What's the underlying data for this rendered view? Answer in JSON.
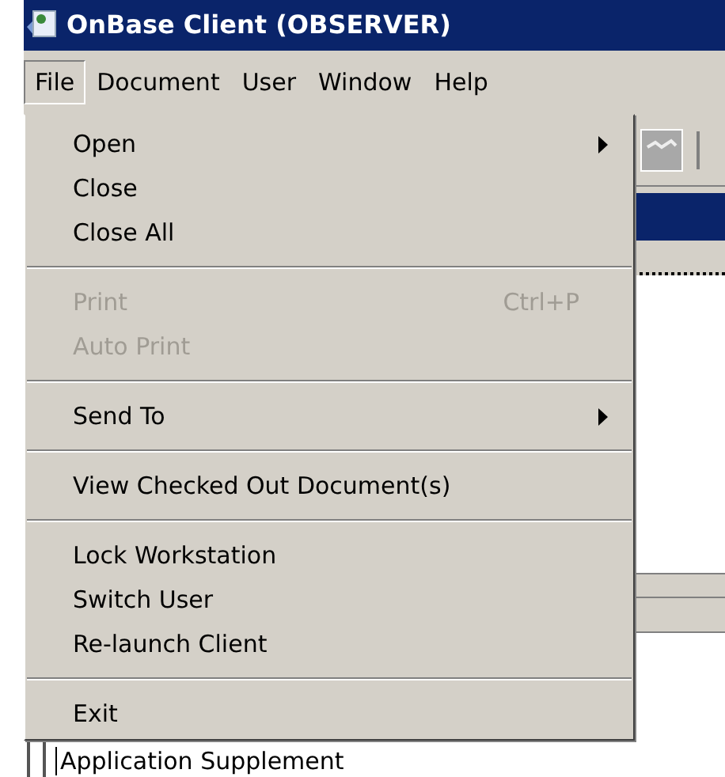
{
  "window": {
    "title": "OnBase Client (OBSERVER)"
  },
  "menu_bar": [
    {
      "label": "File",
      "selected": true
    },
    {
      "label": "Document",
      "selected": false
    },
    {
      "label": "User",
      "selected": false
    },
    {
      "label": "Window",
      "selected": false
    },
    {
      "label": "Help",
      "selected": false
    }
  ],
  "file_menu": [
    {
      "kind": "item",
      "label": "Open",
      "disabled": false,
      "submenu": true
    },
    {
      "kind": "item",
      "label": "Close",
      "disabled": false,
      "submenu": false
    },
    {
      "kind": "item",
      "label": "Close All",
      "disabled": false,
      "submenu": false
    },
    {
      "kind": "separator"
    },
    {
      "kind": "item",
      "label": "Print",
      "shortcut": "Ctrl+P",
      "disabled": true,
      "submenu": false
    },
    {
      "kind": "item",
      "label": "Auto Print",
      "disabled": true,
      "submenu": false
    },
    {
      "kind": "separator"
    },
    {
      "kind": "item",
      "label": "Send To",
      "disabled": false,
      "submenu": true
    },
    {
      "kind": "separator"
    },
    {
      "kind": "item",
      "label": "View Checked Out Document(s)",
      "disabled": false,
      "submenu": false
    },
    {
      "kind": "separator"
    },
    {
      "kind": "item",
      "label": "Lock Workstation",
      "disabled": false,
      "submenu": false
    },
    {
      "kind": "item",
      "label": "Switch User",
      "disabled": false,
      "submenu": false
    },
    {
      "kind": "item",
      "label": "Re-launch Client",
      "disabled": false,
      "submenu": false
    },
    {
      "kind": "separator"
    },
    {
      "kind": "item",
      "label": "Exit",
      "disabled": false,
      "submenu": false
    }
  ],
  "background_list": [
    {
      "label": "Application Supplement"
    }
  ]
}
